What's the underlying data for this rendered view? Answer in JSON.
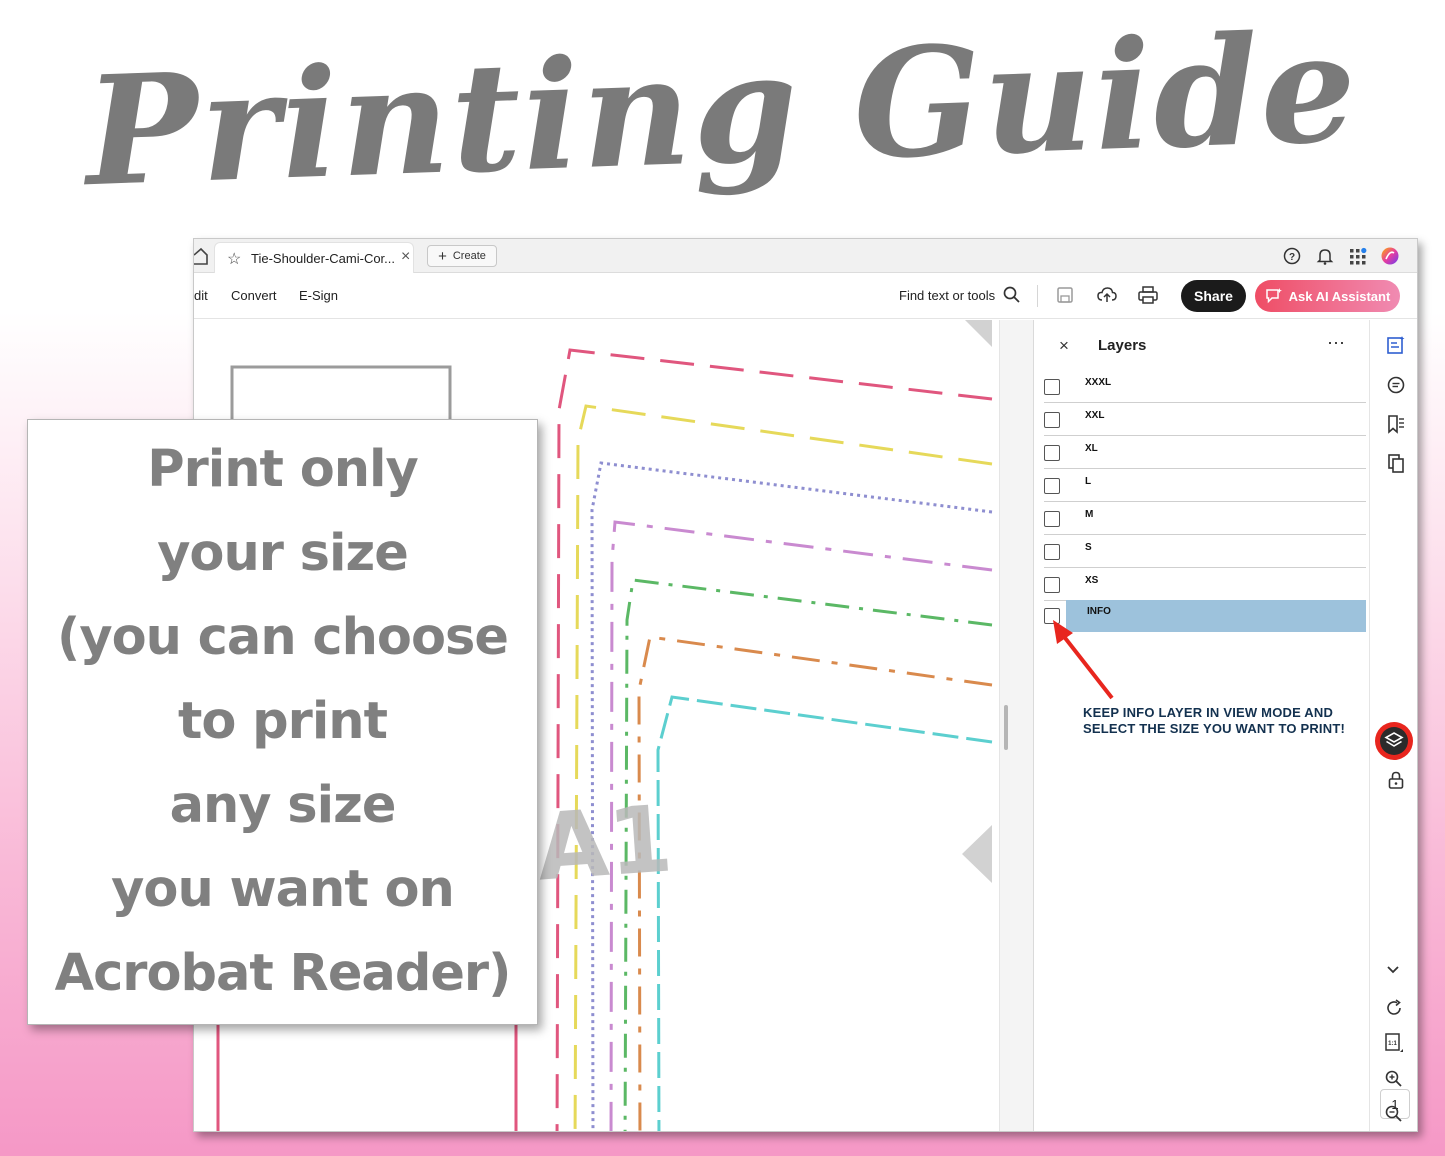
{
  "headline": "Printing Guide",
  "colors": {
    "headline": "#7a7a7a",
    "share_bg": "#1b1b1b",
    "ai_gradient_start": "#ef4d65",
    "ai_gradient_end": "#f08bb2",
    "selected_layer": "#9dc2dc",
    "annotation_arrow": "#e8261e",
    "note_text": "#13314f",
    "pattern_lines": [
      "#e0567e",
      "#e6d95a",
      "#8e8ed0",
      "#c98ad0",
      "#5bb865",
      "#d98a4d",
      "#5ccfcf"
    ]
  },
  "tabbar": {
    "tab_title": "Tie-Shoulder-Cami-Cor...",
    "create_label": "Create",
    "icons": [
      "help-icon",
      "bell-icon",
      "apps-icon",
      "creative-cloud-icon"
    ]
  },
  "toolbar": {
    "menu": [
      "dit",
      "Convert",
      "E-Sign"
    ],
    "find_label": "Find text or tools",
    "share_label": "Share",
    "ai_label": "Ask AI Assistant"
  },
  "canvas": {
    "page_label": "A1"
  },
  "layers": {
    "title": "Layers",
    "items": [
      {
        "name": "XXXL"
      },
      {
        "name": "XXL"
      },
      {
        "name": "XL"
      },
      {
        "name": "L"
      },
      {
        "name": "M"
      },
      {
        "name": "S"
      },
      {
        "name": "XS"
      },
      {
        "name": "INFO",
        "selected": true
      }
    ]
  },
  "note": "KEEP INFO LAYER IN VIEW MODE AND SELECT THE SIZE YOU WANT TO PRINT!",
  "rail": {
    "page_current": "1",
    "page_total": "44"
  },
  "callout": {
    "lines": [
      "Print only",
      "your size",
      "(you can choose",
      "to print",
      "any size",
      "you want on",
      "Acrobat Reader)"
    ]
  }
}
